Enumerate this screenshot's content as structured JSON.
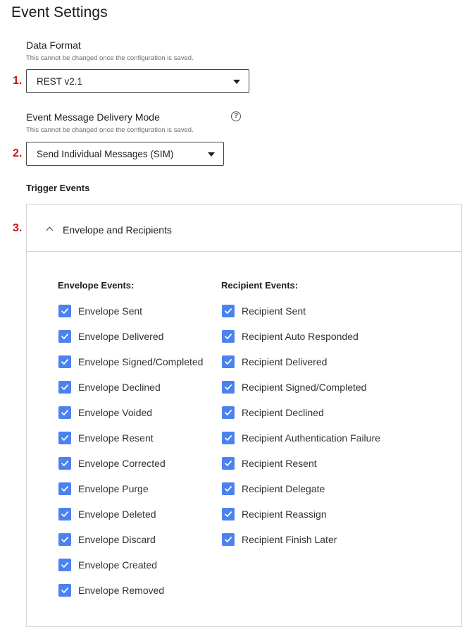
{
  "page": {
    "title": "Event Settings"
  },
  "data_format": {
    "label": "Data Format",
    "hint": "This cannot be changed once the configuration is saved.",
    "step": "1.",
    "value": "REST v2.1"
  },
  "delivery_mode": {
    "label": "Event Message Delivery Mode",
    "hint": "This cannot be changed once the configuration is saved.",
    "step": "2.",
    "value": "Send Individual Messages (SIM)",
    "help_icon": "?"
  },
  "trigger_events": {
    "title": "Trigger Events",
    "step": "3.",
    "panel_title": "Envelope and Recipients",
    "checkbox_color": "#4c82f0",
    "envelope_heading": "Envelope Events:",
    "recipient_heading": "Recipient Events:",
    "envelope_events": [
      {
        "label": "Envelope Sent",
        "checked": true
      },
      {
        "label": "Envelope Delivered",
        "checked": true
      },
      {
        "label": "Envelope Signed/Completed",
        "checked": true
      },
      {
        "label": "Envelope Declined",
        "checked": true
      },
      {
        "label": "Envelope Voided",
        "checked": true
      },
      {
        "label": "Envelope Resent",
        "checked": true
      },
      {
        "label": "Envelope Corrected",
        "checked": true
      },
      {
        "label": "Envelope Purge",
        "checked": true
      },
      {
        "label": "Envelope Deleted",
        "checked": true
      },
      {
        "label": "Envelope Discard",
        "checked": true
      },
      {
        "label": "Envelope Created",
        "checked": true
      },
      {
        "label": "Envelope Removed",
        "checked": true
      }
    ],
    "recipient_events": [
      {
        "label": "Recipient Sent",
        "checked": true
      },
      {
        "label": "Recipient Auto Responded",
        "checked": true
      },
      {
        "label": "Recipient Delivered",
        "checked": true
      },
      {
        "label": "Recipient Signed/Completed",
        "checked": true
      },
      {
        "label": "Recipient Declined",
        "checked": true
      },
      {
        "label": "Recipient Authentication Failure",
        "checked": true
      },
      {
        "label": "Recipient Resent",
        "checked": true
      },
      {
        "label": "Recipient Delegate",
        "checked": true
      },
      {
        "label": "Recipient Reassign",
        "checked": true
      },
      {
        "label": "Recipient Finish Later",
        "checked": true
      }
    ]
  }
}
